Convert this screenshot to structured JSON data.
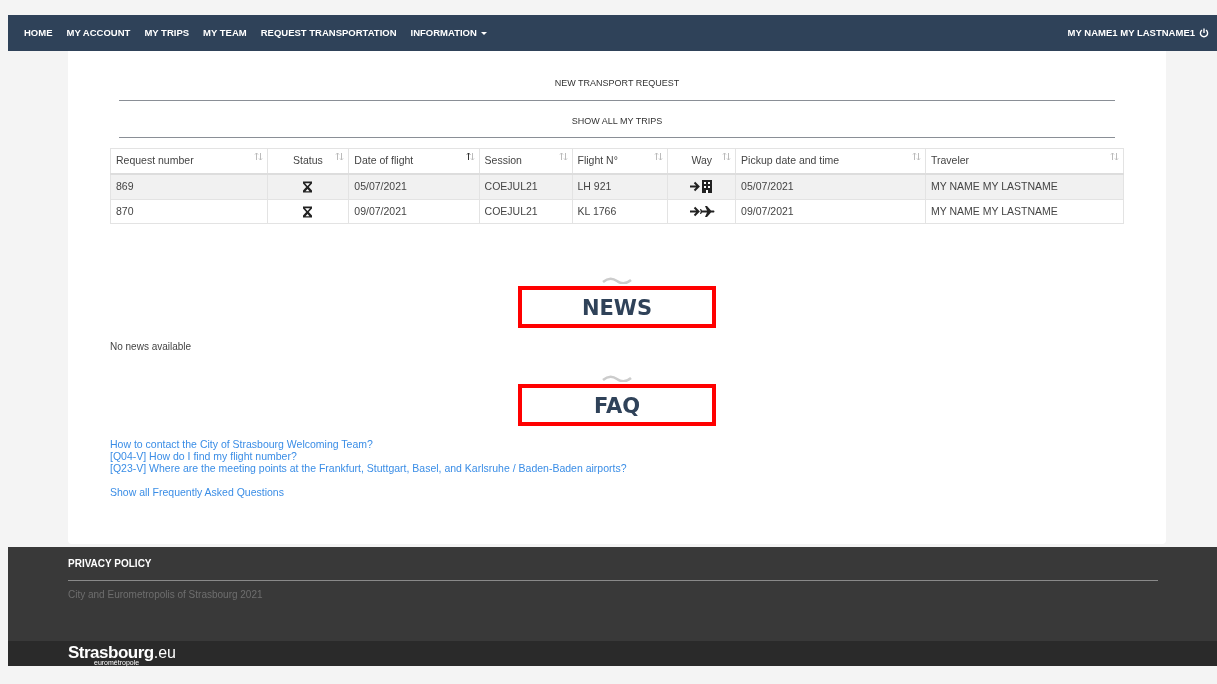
{
  "navbar": {
    "items": [
      {
        "label": "HOME",
        "dropdown": false
      },
      {
        "label": "MY ACCOUNT",
        "dropdown": false
      },
      {
        "label": "MY TRIPS",
        "dropdown": false
      },
      {
        "label": "MY TEAM",
        "dropdown": false
      },
      {
        "label": "REQUEST TRANSPORTATION",
        "dropdown": false
      },
      {
        "label": "INFORMATION",
        "dropdown": true
      }
    ],
    "user": "MY NAME1 MY LASTNAME1"
  },
  "actions": [
    "NEW TRANSPORT REQUEST",
    "SHOW ALL MY TRIPS"
  ],
  "table": {
    "columns": [
      {
        "label": "Request number",
        "sorted": false
      },
      {
        "label": "Status",
        "sorted": false
      },
      {
        "label": "Date of flight",
        "sorted": true
      },
      {
        "label": "Session",
        "sorted": false
      },
      {
        "label": "Flight N°",
        "sorted": false
      },
      {
        "label": "Way",
        "sorted": false
      },
      {
        "label": "Pickup date and time",
        "sorted": false
      },
      {
        "label": "Traveler",
        "sorted": false
      }
    ],
    "rows": [
      {
        "request": "869",
        "status": {
          "kind": "pending"
        },
        "date": "05/07/2021",
        "session": "COEJUL21",
        "flight": "LH 921",
        "way": {
          "kind": "to-building"
        },
        "pickup": "05/07/2021",
        "traveler": "MY NAME MY LASTNAME"
      },
      {
        "request": "870",
        "status": {
          "kind": "pending"
        },
        "date": "09/07/2021",
        "session": "COEJUL21",
        "flight": "KL 1766",
        "way": {
          "kind": "to-plane"
        },
        "pickup": "09/07/2021",
        "traveler": "MY NAME MY LASTNAME"
      }
    ]
  },
  "news": {
    "title": "NEWS",
    "highlighted": true,
    "empty_text": "No news available"
  },
  "faq": {
    "title": "FAQ",
    "highlighted": true,
    "questions": [
      "How to contact the City of Strasbourg Welcoming Team?",
      "[Q04-V] How do I find my flight number?",
      "[Q23-V] Where are the meeting points at the Frankfurt, Stuttgart, Basel, and Karlsruhe / Baden-Baden airports?"
    ],
    "show_all": "Show all Frequently Asked Questions"
  },
  "footer": {
    "link": "PRIVACY POLICY",
    "copyright": "City and Eurometropolis of Strasbourg 2021",
    "logo": {
      "main": "Strasbourg",
      "suffix": ".eu",
      "sub": "eurométropole"
    }
  }
}
